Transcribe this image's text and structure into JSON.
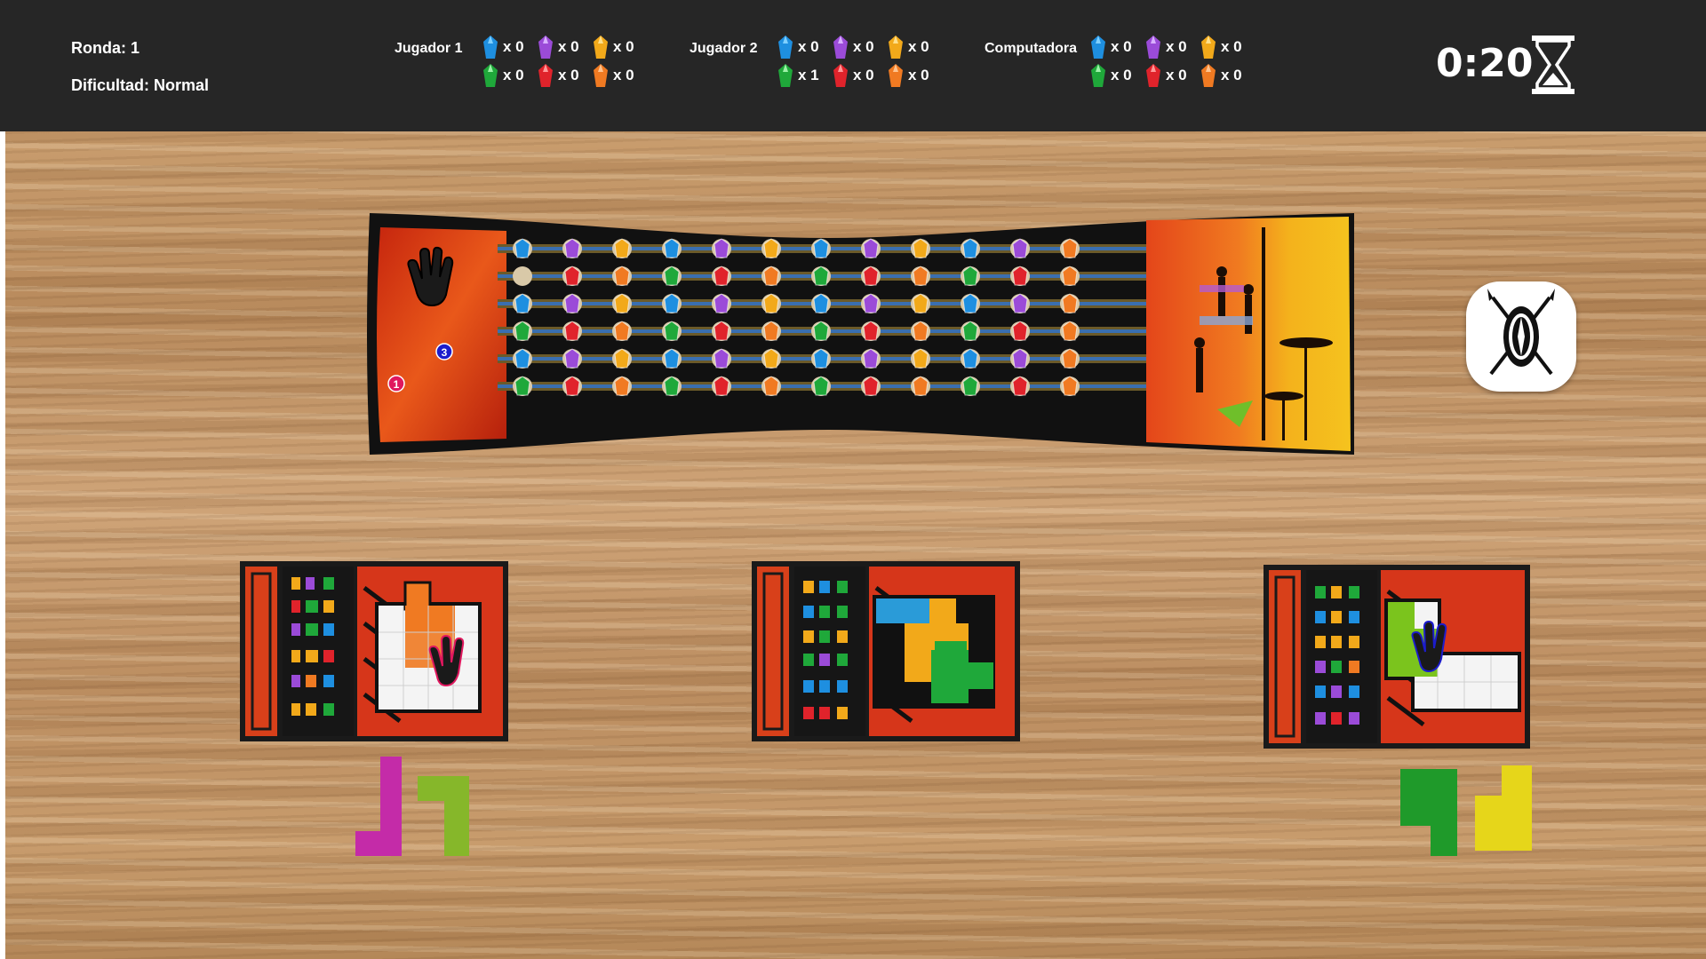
{
  "hud": {
    "round_label": "Ronda: 1",
    "difficulty_label": "Dificultad: Normal",
    "timer": "0:20"
  },
  "gem_colors": {
    "blue": "#1e8fe0",
    "purple": "#9b4bd8",
    "yellow": "#f2a91a",
    "green": "#1fa83a",
    "red": "#e0232b",
    "orange": "#f07a22"
  },
  "players": [
    {
      "name": "Jugador 1",
      "row1": [
        {
          "gem": "blue-gem-icon",
          "count": "x 0"
        },
        {
          "gem": "purple-gem-icon",
          "count": "x 0"
        },
        {
          "gem": "yellow-gem-icon",
          "count": "x 0"
        }
      ],
      "row2": [
        {
          "gem": "green-gem-icon",
          "count": "x 0"
        },
        {
          "gem": "red-gem-icon",
          "count": "x 0"
        },
        {
          "gem": "orange-gem-icon",
          "count": "x 0"
        }
      ]
    },
    {
      "name": "Jugador 2",
      "row1": [
        {
          "gem": "blue-gem-icon",
          "count": "x 0"
        },
        {
          "gem": "purple-gem-icon",
          "count": "x 0"
        },
        {
          "gem": "yellow-gem-icon",
          "count": "x 0"
        }
      ],
      "row2": [
        {
          "gem": "green-gem-icon",
          "count": "x 1"
        },
        {
          "gem": "red-gem-icon",
          "count": "x 0"
        },
        {
          "gem": "orange-gem-icon",
          "count": "x 0"
        }
      ]
    },
    {
      "name": "Computadora",
      "row1": [
        {
          "gem": "blue-gem-icon",
          "count": "x 0"
        },
        {
          "gem": "purple-gem-icon",
          "count": "x 0"
        },
        {
          "gem": "yellow-gem-icon",
          "count": "x 0"
        }
      ],
      "row2": [
        {
          "gem": "green-gem-icon",
          "count": "x 0"
        },
        {
          "gem": "red-gem-icon",
          "count": "x 0"
        },
        {
          "gem": "orange-gem-icon",
          "count": "x 0"
        }
      ]
    }
  ],
  "board": {
    "marker_blue_label": "3",
    "marker_pink_label": "1",
    "track_rows": [
      [
        "blue",
        "purple",
        "yellow",
        "blue",
        "purple",
        "yellow",
        "blue",
        "purple",
        "yellow",
        "blue",
        "purple",
        "orange"
      ],
      [
        "empty",
        "red",
        "orange",
        "green",
        "red",
        "orange",
        "green",
        "red",
        "orange",
        "green",
        "red",
        "orange"
      ],
      [
        "blue",
        "purple",
        "yellow",
        "blue",
        "purple",
        "yellow",
        "blue",
        "purple",
        "yellow",
        "blue",
        "purple",
        "orange"
      ],
      [
        "green",
        "red",
        "orange",
        "green",
        "red",
        "orange",
        "green",
        "red",
        "orange",
        "green",
        "red",
        "orange"
      ],
      [
        "blue",
        "purple",
        "yellow",
        "blue",
        "purple",
        "yellow",
        "blue",
        "purple",
        "yellow",
        "blue",
        "purple",
        "orange"
      ],
      [
        "green",
        "red",
        "orange",
        "green",
        "red",
        "orange",
        "green",
        "red",
        "orange",
        "green",
        "red",
        "orange"
      ]
    ]
  }
}
